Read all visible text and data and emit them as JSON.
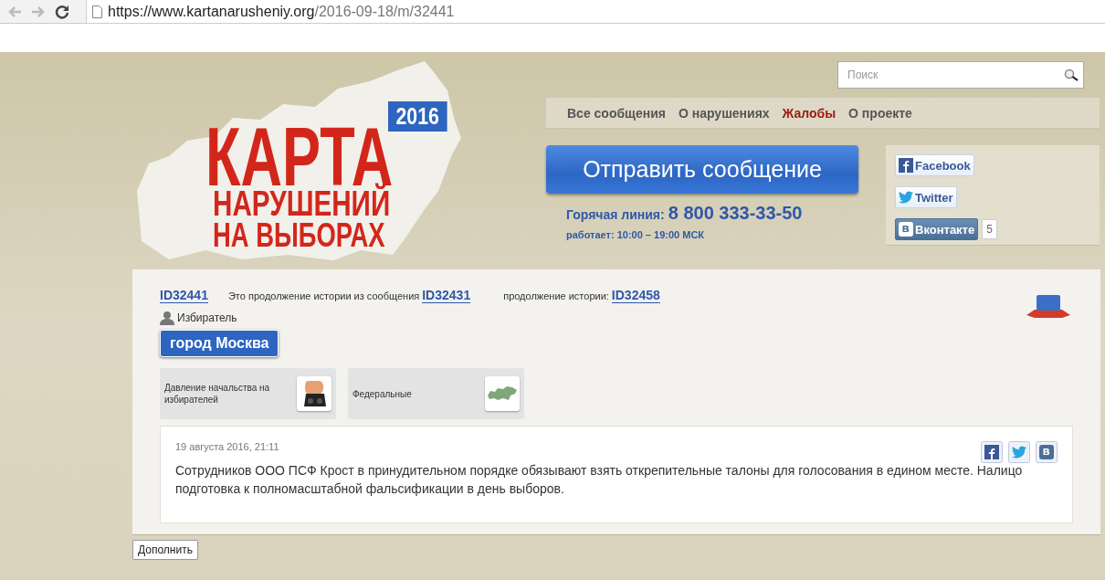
{
  "browser": {
    "url_host": "https://www.kartanarusheniy.org",
    "url_path": "/2016-09-18/m/32441"
  },
  "logo": {
    "year": "2016",
    "title": "КАРТА",
    "subtitle_1": "НАРУШЕНИЙ",
    "subtitle_2": "НА ВЫБОРАХ"
  },
  "search": {
    "placeholder": "Поиск"
  },
  "nav": [
    {
      "label": "Все сообщения",
      "selected": false
    },
    {
      "label": "О нарушениях",
      "selected": false
    },
    {
      "label": "Жалобы",
      "selected": true
    },
    {
      "label": "О проекте",
      "selected": false
    }
  ],
  "send_button": "Отправить сообщение",
  "hotline": {
    "label": "Горячая линия:",
    "phone": "8 800 333-33-50",
    "hours": "работает: 10:00 – 19:00 МСК"
  },
  "social": [
    {
      "kind": "facebook",
      "label": "Facebook"
    },
    {
      "kind": "twitter",
      "label": "Twitter"
    },
    {
      "kind": "vkontakte",
      "label": "Вконтакте",
      "count": "5"
    }
  ],
  "message": {
    "id": "ID32441",
    "continued_from_text": "Это продолжение истории из сообщения",
    "continued_from_id": "ID32431",
    "continuation_text": "продолжение истории:",
    "continuation_id": "ID32458",
    "author": "Избиратель",
    "region": "город Москва",
    "categories": [
      {
        "kind": "pressure",
        "label": "Давление начальства на избирателей"
      },
      {
        "kind": "federal",
        "label": "Федеральные"
      }
    ],
    "date": "19 августа 2016, 21:11",
    "text": "Сотрудников ООО ПСФ Крост в принудительном порядке обязывают взять открепительные талоны для голосования в едином месте. Налицо подготовка к полномасштабной фальсификации в день выборов."
  },
  "add_button": "Дополнить"
}
